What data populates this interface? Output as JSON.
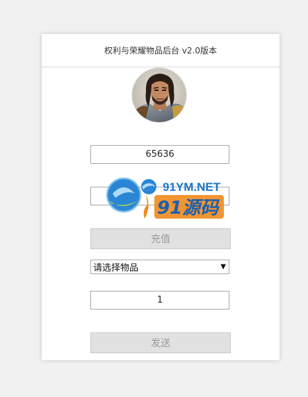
{
  "header": {
    "title": "权利与荣耀物品后台 v2.0版本"
  },
  "account": {
    "value": "65636"
  },
  "amount": {
    "value": ""
  },
  "recharge": {
    "label": "充值"
  },
  "item_select": {
    "selected": "请选择物品"
  },
  "quantity": {
    "value": "1"
  },
  "send": {
    "label": "发送"
  },
  "watermark": {
    "latin": "91YM.NET",
    "chinese": "91源码"
  },
  "colors": {
    "page_bg": "#f1f1f1",
    "card_bg": "#ffffff",
    "button_bg": "#e1e1e1",
    "button_text": "#9a9a9a",
    "watermark_blue": "#1a73c8",
    "watermark_orange": "#f08a1c"
  }
}
